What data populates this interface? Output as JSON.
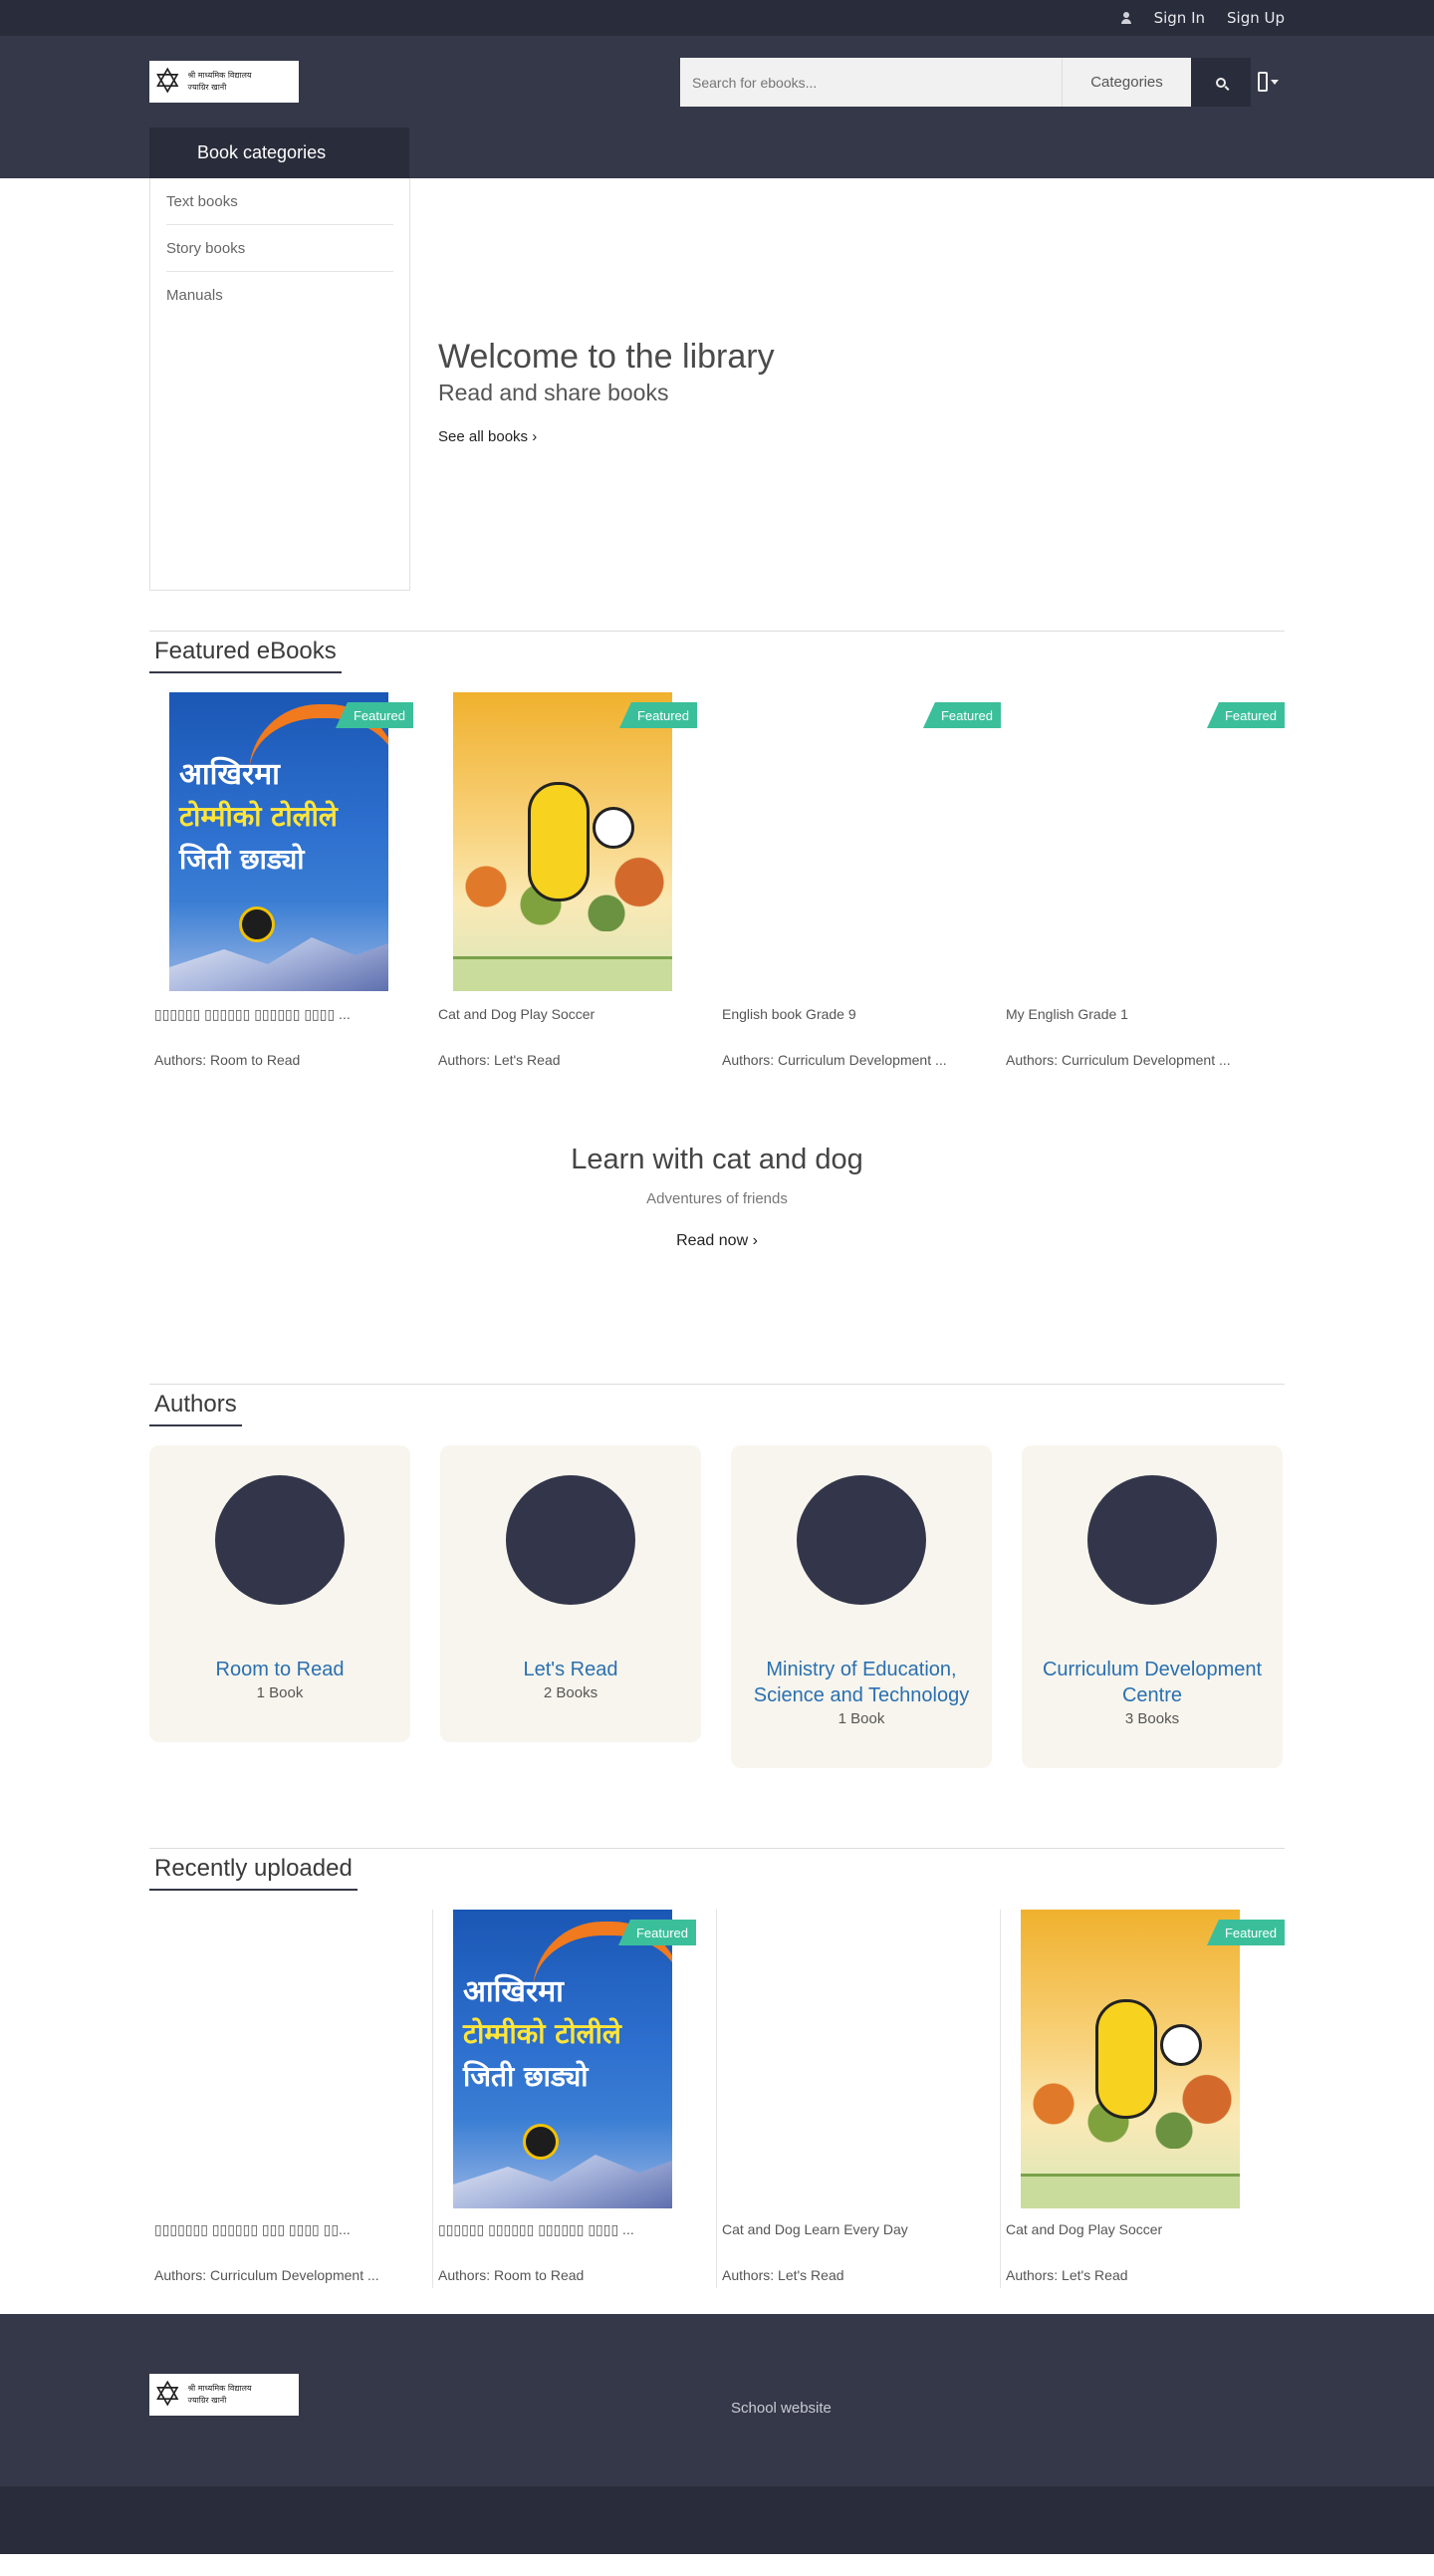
{
  "topbar": {
    "sign_in": "Sign In",
    "sign_up": "Sign Up"
  },
  "header": {
    "logo_line1": "श्री माध्यमिक विद्यालय",
    "logo_line2": "ज्याग्रिर खानी",
    "search_placeholder": "Search for ebooks...",
    "categories_label": "Categories",
    "book_categories_title": "Book categories"
  },
  "sidebar": {
    "items": [
      {
        "label": "Text books"
      },
      {
        "label": "Story books"
      },
      {
        "label": "Manuals"
      }
    ]
  },
  "hero": {
    "title": "Welcome to the library",
    "subtitle": "Read and share books",
    "link": "See all books"
  },
  "featured": {
    "heading": "Featured eBooks",
    "ribbon": "Featured",
    "books": [
      {
        "name": "▯▯▯▯▯▯ ▯▯▯▯▯▯ ▯▯▯▯▯▯ ▯▯▯▯ ...",
        "authors": "Authors: Room to Read",
        "cover": "nepali"
      },
      {
        "name": "Cat and Dog Play Soccer",
        "authors": "Authors: Let's Read",
        "cover": "catdog"
      },
      {
        "name": "English book Grade 9",
        "authors": "Authors: Curriculum Development ...",
        "cover": "none"
      },
      {
        "name": "My English Grade 1",
        "authors": "Authors: Curriculum Development ...",
        "cover": "none"
      }
    ]
  },
  "promo": {
    "title": "Learn with cat and dog",
    "subtitle": "Adventures of friends",
    "link": "Read now"
  },
  "authors": {
    "heading": "Authors",
    "list": [
      {
        "name": "Room to Read",
        "count": "1 Book"
      },
      {
        "name": "Let's Read",
        "count": "2 Books"
      },
      {
        "name": "Ministry of Education, Science and Technology",
        "count": "1 Book"
      },
      {
        "name": "Curriculum Development Centre",
        "count": "3 Books"
      }
    ]
  },
  "recent": {
    "heading": "Recently uploaded",
    "ribbon": "Featured",
    "books": [
      {
        "name": "▯▯▯▯▯▯▯ ▯▯▯▯▯▯ ▯▯▯ ▯▯▯▯ ▯▯...",
        "authors": "Authors: Curriculum Development ..."
      },
      {
        "name": "▯▯▯▯▯▯ ▯▯▯▯▯▯ ▯▯▯▯▯▯ ▯▯▯▯ ...",
        "authors": "Authors: Room to Read"
      },
      {
        "name": "Cat and Dog Learn Every Day",
        "authors": "Authors: Let's Read"
      },
      {
        "name": "Cat and Dog Play Soccer",
        "authors": "Authors: Let's Read"
      }
    ]
  },
  "footer": {
    "link": "School website"
  },
  "colors": {
    "dark": "#292c3a",
    "header": "#353848",
    "ribbon": "#3bbf9b",
    "author_link": "#2a6fb0",
    "author_card": "#f7f5ed"
  }
}
